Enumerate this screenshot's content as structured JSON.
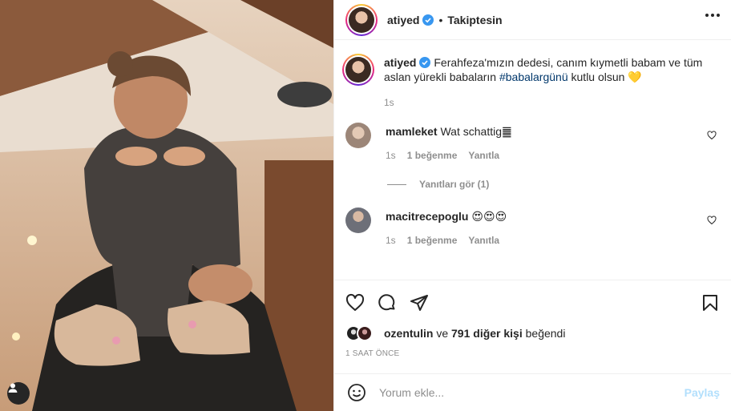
{
  "post": {
    "author": "atiyed",
    "follow_state": "Takiptesin",
    "separator": "•",
    "caption_author": "atiyed",
    "caption_text_before": "Ferahfeza'mızın dedesi, canım kıymetli babam ve tüm aslan yürekli babaların ",
    "caption_hashtag": "#babalargünü",
    "caption_text_after": " kutlu olsun 💛",
    "caption_age": "1s"
  },
  "comments": [
    {
      "user": "mamleket",
      "text": "Wat schattig䷀",
      "age": "1s",
      "likes": "1 beğenme",
      "reply": "Yanıtla",
      "view_replies": "Yanıtları gör (1)"
    },
    {
      "user": "macitrecepoglu",
      "text": "😍😍😍",
      "age": "1s",
      "likes": "1 beğenme",
      "reply": "Yanıtla"
    }
  ],
  "likes_line": {
    "user": "ozentulin",
    "connector": " ve ",
    "others": "791 diğer kişi",
    "suffix": " beğendi"
  },
  "timestamp": "1 SAAT ÖNCE",
  "composer": {
    "placeholder": "Yorum ekle...",
    "share_label": "Paylaş"
  },
  "icons": {
    "verified": "verified-badge-icon",
    "more": "more-options-icon",
    "like": "heart-icon",
    "comment": "comment-icon",
    "share": "paper-plane-icon",
    "save": "bookmark-icon",
    "emoji": "emoji-icon",
    "tag": "user-tag-icon"
  },
  "colors": {
    "verified_blue": "#3897f0",
    "hashtag": "#00376b",
    "muted": "#8e8e8e",
    "share_disabled": "#b2dffc"
  }
}
